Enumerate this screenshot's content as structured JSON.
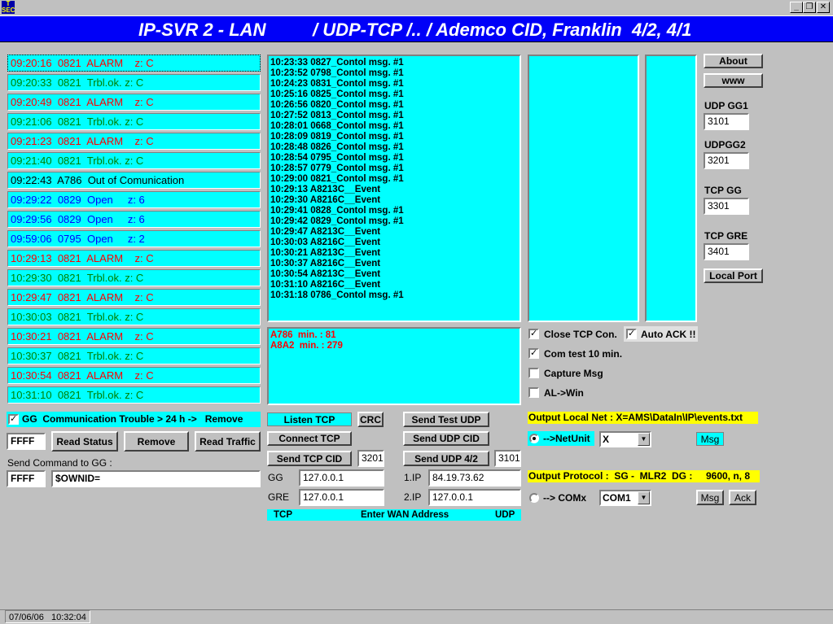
{
  "window": {
    "logo_text": "T\nSEC",
    "minimize": "_",
    "restore": "❐",
    "close": "✕"
  },
  "banner": {
    "left": "IP-SVR 2 - LAN",
    "right": "/ UDP-TCP /.. / Ademco CID, Franklin  4/2, 4/1"
  },
  "alarms": [
    {
      "text": "09:20:16  0821  ALARM    z: C",
      "color": "red",
      "selected": true
    },
    {
      "text": "09:20:33  0821  Trbl.ok. z: C",
      "color": "green"
    },
    {
      "text": "09:20:49  0821  ALARM    z: C",
      "color": "red"
    },
    {
      "text": "09:21:06  0821  Trbl.ok. z: C",
      "color": "green"
    },
    {
      "text": "09:21:23  0821  ALARM    z: C",
      "color": "red"
    },
    {
      "text": "09:21:40  0821  Trbl.ok. z: C",
      "color": "green"
    },
    {
      "text": "09:22:43  A786  Out of Comunication",
      "color": "black"
    },
    {
      "text": "09:29:22  0829  Open     z: 6",
      "color": "blue"
    },
    {
      "text": "09:29:56  0829  Open     z: 6",
      "color": "blue"
    },
    {
      "text": "09:59:06  0795  Open     z: 2",
      "color": "blue"
    },
    {
      "text": "10:29:13  0821  ALARM    z: C",
      "color": "red"
    },
    {
      "text": "10:29:30  0821  Trbl.ok. z: C",
      "color": "green"
    },
    {
      "text": "10:29:47  0821  ALARM    z: C",
      "color": "red"
    },
    {
      "text": "10:30:03  0821  Trbl.ok. z: C",
      "color": "green"
    },
    {
      "text": "10:30:21  0821  ALARM    z: C",
      "color": "red"
    },
    {
      "text": "10:30:37  0821  Trbl.ok. z: C",
      "color": "green"
    },
    {
      "text": "10:30:54  0821  ALARM    z: C",
      "color": "red"
    },
    {
      "text": "10:31:10  0821  Trbl.ok. z: C",
      "color": "green"
    }
  ],
  "log_lines": [
    "10:23:33 0827_Contol msg. #1",
    "10:23:52 0798_Contol msg. #1",
    "10:24:23 0831_Contol msg. #1",
    "10:25:16 0825_Contol msg. #1",
    "10:26:56 0820_Contol msg. #1",
    "10:27:52 0813_Contol msg. #1",
    "10:28:01 0668_Contol msg. #1",
    "10:28:09 0819_Contol msg. #1",
    "10:28:48 0826_Contol msg. #1",
    "10:28:54 0795_Contol msg. #1",
    "10:28:57 0779_Contol msg. #1",
    "10:29:00 0821_Contol msg. #1",
    "10:29:13 A8213C__Event",
    "10:29:30 A8216C__Event",
    "10:29:41 0828_Contol msg. #1",
    "10:29:42 0829_Contol msg. #1",
    "10:29:47 A8213C__Event",
    "10:30:03 A8216C__Event",
    "10:30:21 A8213C__Event",
    "10:30:37 A8216C__Event",
    "10:30:54 A8213C__Event",
    "10:31:10 A8216C__Event",
    "10:31:18 0786_Contol msg. #1"
  ],
  "comm_lines": [
    "A786  min. : 81",
    "A8A2  min. : 279"
  ],
  "right_panel": {
    "about": "About",
    "www": "www",
    "udp_gg1_label": "UDP GG1",
    "udp_gg1_value": "3101",
    "udp_gg2_label": "UDPGG2",
    "udp_gg2_value": "3201",
    "tcp_gg_label": "TCP GG",
    "tcp_gg_value": "3301",
    "tcp_gre_label": "TCP GRE",
    "tcp_gre_value": "3401",
    "local_port": "Local Port"
  },
  "options": {
    "close_tcp": "Close TCP Con.",
    "auto_ack": "Auto ACK !!",
    "com_test": "Com test 10 min.",
    "capture": "Capture Msg",
    "al_win": "AL->Win",
    "close_tcp_checked": true,
    "auto_ack_checked": true,
    "com_test_checked": true,
    "capture_checked": false,
    "al_win_checked": false
  },
  "gg_bar": {
    "checked": true,
    "text": "GG  Communication Trouble > 24 h ->   Remove"
  },
  "commands": {
    "id_value": "FFFF",
    "read_status": "Read Status",
    "remove": "Remove",
    "read_traffic": "Read Traffic",
    "send_label": "Send Command to GG :",
    "send_id": "FFFF",
    "send_cmd": "$OWNID="
  },
  "network": {
    "listen_tcp": "Listen TCP",
    "crc": "CRC",
    "connect_tcp": "Connect TCP",
    "send_tcp_cid": "Send TCP CID",
    "tcp_port": "3201",
    "gg_label": "GG",
    "gg_ip": "127.0.0.1",
    "gre_label": "GRE",
    "gre_ip": "127.0.0.1",
    "send_test_udp": "Send Test UDP",
    "send_udp_cid": "Send UDP CID",
    "send_udp_42": "Send UDP 4/2",
    "udp_port": "3101",
    "ip1_label": "1.IP",
    "ip1": "84.19.73.62",
    "ip2_label": "2.IP",
    "ip2": "127.0.0.1",
    "wan_left": "TCP",
    "wan_center": "Enter WAN Address",
    "wan_right": "UDP"
  },
  "output": {
    "local_net": "Output Local Net : X=AMS\\DataIn\\IP\\events.txt",
    "netunit_label": "-->NetUnit",
    "netunit_value": "X",
    "msg1": "Msg",
    "protocol": "Output Protocol :  SG -  MLR2  DG :     9600, n, 8",
    "comx_label": "--> COMx",
    "comx_value": "COM1",
    "msg2": "Msg",
    "ack": "Ack"
  },
  "status": {
    "date": "07/06/06",
    "time": "10:32:04"
  },
  "colors": {
    "cyan": "#00ffff",
    "banner": "#0000f8",
    "yellow": "#ffff00",
    "red": "#ff0000",
    "green": "#008000",
    "blue": "#0000ff"
  }
}
